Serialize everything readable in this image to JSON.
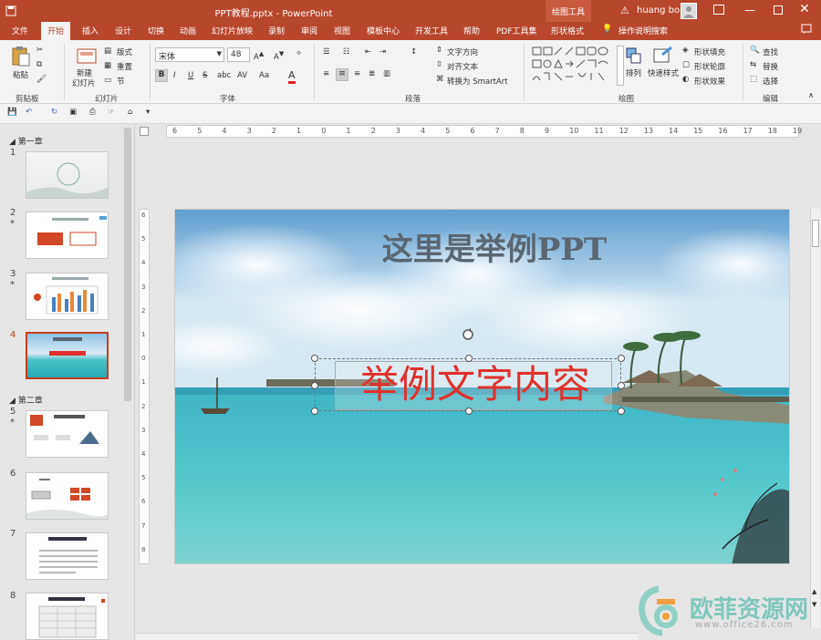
{
  "window": {
    "title": "PPT教程.pptx  -  PowerPoint",
    "context_tab": "绘图工具",
    "user": "huang bo"
  },
  "tabs": [
    "文件",
    "开始",
    "插入",
    "设计",
    "切换",
    "动画",
    "幻灯片放映",
    "录制",
    "审阅",
    "视图",
    "模板中心",
    "开发工具",
    "帮助",
    "PDF工具集",
    "形状格式"
  ],
  "tell_me": "操作说明搜索",
  "ribbon": {
    "clipboard": {
      "paste": "粘贴",
      "group": "剪贴板"
    },
    "slides": {
      "new_line1": "新建",
      "new_line2": "幻灯片",
      "layout": "版式",
      "reset": "重置",
      "section": "节",
      "group": "幻灯片"
    },
    "font": {
      "name": "宋体",
      "size": "48",
      "group": "字体",
      "bold": "B",
      "italic": "I",
      "underline": "U",
      "strike": "S",
      "shadow": "abc",
      "spacing": "AV",
      "case": "Aa",
      "color_a": "A"
    },
    "paragraph": {
      "direction": "文字方向",
      "align_text": "对齐文本",
      "smartart": "转换为 SmartArt",
      "group": "段落"
    },
    "drawing": {
      "arrange": "排列",
      "quick_styles": "快速样式",
      "fill": "形状填充",
      "outline": "形状轮廓",
      "effects": "形状效果",
      "group": "绘图"
    },
    "editing": {
      "find": "查找",
      "replace": "替换",
      "select": "选择",
      "group": "编辑"
    }
  },
  "ruler_h": [
    "6",
    "5",
    "4",
    "3",
    "2",
    "1",
    "0",
    "1",
    "2",
    "3",
    "4",
    "5",
    "6",
    "7",
    "8",
    "9",
    "10",
    "11",
    "12",
    "13",
    "14",
    "15",
    "16",
    "17",
    "18",
    "19"
  ],
  "ruler_v": [
    "6",
    "5",
    "4",
    "3",
    "2",
    "1",
    "0",
    "1",
    "2",
    "3",
    "4",
    "5",
    "6",
    "7",
    "8"
  ],
  "thumbnails": {
    "sections": [
      "第一章",
      "第二章"
    ],
    "slides": [
      {
        "num": "1",
        "star": ""
      },
      {
        "num": "2",
        "star": "*"
      },
      {
        "num": "3",
        "star": "*"
      },
      {
        "num": "4",
        "star": ""
      },
      {
        "num": "5",
        "star": "*"
      },
      {
        "num": "6",
        "star": ""
      },
      {
        "num": "7",
        "star": ""
      },
      {
        "num": "8",
        "star": ""
      }
    ],
    "selected": 4
  },
  "slide": {
    "title": "这里是举例PPT",
    "body": "举例文字内容",
    "colors": {
      "title": "#5b6670",
      "body": "#e0312c"
    }
  },
  "watermark": {
    "brand": "欧菲资源网",
    "url": "www.office26.com"
  },
  "colors": {
    "accent": "#b7472a",
    "selection": "#c43e1c"
  }
}
